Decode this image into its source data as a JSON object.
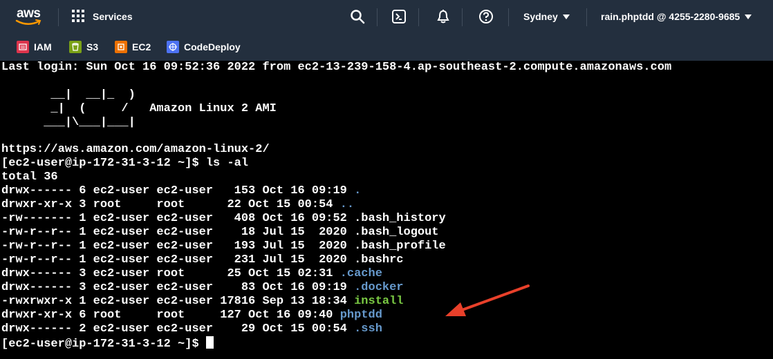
{
  "topnav": {
    "logo": "aws",
    "services_label": "Services",
    "region": "Sydney",
    "account": "rain.phptdd @ 4255-2280-9685",
    "icons": [
      "search-icon",
      "cloudshell-icon",
      "notifications-icon",
      "help-icon"
    ]
  },
  "favorites": [
    {
      "label": "IAM",
      "color": "#dd344c"
    },
    {
      "label": "S3",
      "color": "#7aa116"
    },
    {
      "label": "EC2",
      "color": "#ed7100"
    },
    {
      "label": "CodeDeploy",
      "color": "#4d72f3"
    }
  ],
  "terminal": {
    "last_login": "Last login: Sun Oct 16 09:52:36 2022 from ec2-13-239-158-4.ap-southeast-2.compute.amazonaws.com",
    "banner_1": "       __|  __|_  )",
    "banner_2": "       _|  (     /   Amazon Linux 2 AMI",
    "banner_3": "      ___|\\___|___|",
    "url": "https://aws.amazon.com/amazon-linux-2/",
    "prompt_1": "[ec2-user@ip-172-31-3-12 ~]$ ls -al",
    "total": "total 36",
    "entries": [
      {
        "meta": "drwx------ 6 ec2-user ec2-user   153 Oct 16 09:19 ",
        "name": ".",
        "type": "dir"
      },
      {
        "meta": "drwxr-xr-x 3 root     root      22 Oct 15 00:54 ",
        "name": "..",
        "type": "dir"
      },
      {
        "meta": "-rw------- 1 ec2-user ec2-user   408 Oct 16 09:52 ",
        "name": ".bash_history",
        "type": "file"
      },
      {
        "meta": "-rw-r--r-- 1 ec2-user ec2-user    18 Jul 15  2020 ",
        "name": ".bash_logout",
        "type": "file"
      },
      {
        "meta": "-rw-r--r-- 1 ec2-user ec2-user   193 Jul 15  2020 ",
        "name": ".bash_profile",
        "type": "file"
      },
      {
        "meta": "-rw-r--r-- 1 ec2-user ec2-user   231 Jul 15  2020 ",
        "name": ".bashrc",
        "type": "file"
      },
      {
        "meta": "drwx------ 3 ec2-user root      25 Oct 15 02:31 ",
        "name": ".cache",
        "type": "dir"
      },
      {
        "meta": "drwx------ 3 ec2-user ec2-user    83 Oct 16 09:19 ",
        "name": ".docker",
        "type": "dir"
      },
      {
        "meta": "-rwxrwxr-x 1 ec2-user ec2-user 17816 Sep 13 18:34 ",
        "name": "install",
        "type": "exe"
      },
      {
        "meta": "drwxr-xr-x 6 root     root     127 Oct 16 09:40 ",
        "name": "phptdd",
        "type": "dir"
      },
      {
        "meta": "drwx------ 2 ec2-user ec2-user    29 Oct 15 00:54 ",
        "name": ".ssh",
        "type": "dir"
      }
    ],
    "prompt_2": "[ec2-user@ip-172-31-3-12 ~]$ ",
    "colors": {
      "dir": "#6699cc",
      "exe": "#7ac943",
      "arrow": "#e8402a"
    }
  }
}
